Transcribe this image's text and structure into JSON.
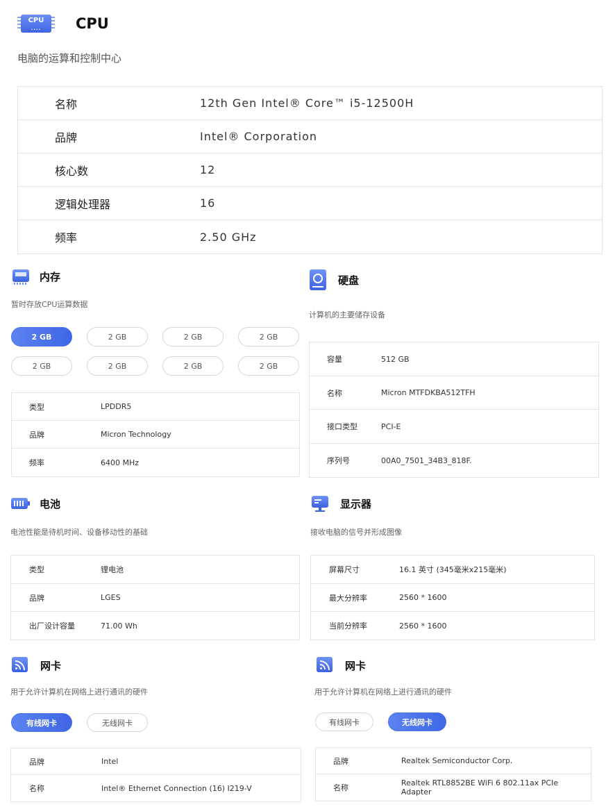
{
  "cpu": {
    "chip_label": "CPU",
    "title": "CPU",
    "description": "电脑的运算和控制中心",
    "rows": [
      {
        "label": "名称",
        "value": "12th Gen Intel® Core™ i5-12500H"
      },
      {
        "label": "品牌",
        "value": "Intel® Corporation"
      },
      {
        "label": "核心数",
        "value": "12"
      },
      {
        "label": "逻辑处理器",
        "value": "16"
      },
      {
        "label": "频率",
        "value": "2.50 GHz"
      }
    ]
  },
  "memory": {
    "title": "内存",
    "description": "暂时存放CPU运算数据",
    "modules": [
      "2 GB",
      "2 GB",
      "2 GB",
      "2 GB",
      "2 GB",
      "2 GB",
      "2 GB",
      "2 GB"
    ],
    "selected_index": 0,
    "rows": [
      {
        "label": "类型",
        "value": "LPDDR5"
      },
      {
        "label": "品牌",
        "value": "Micron Technology"
      },
      {
        "label": "频率",
        "value": "6400 MHz"
      }
    ]
  },
  "disk": {
    "title": "硬盘",
    "description": "计算机的主要储存设备",
    "rows": [
      {
        "label": "容量",
        "value": "512 GB"
      },
      {
        "label": "名称",
        "value": "Micron MTFDKBA512TFH"
      },
      {
        "label": "接口类型",
        "value": "PCI-E"
      },
      {
        "label": "序列号",
        "value": "00A0_7501_34B3_818F."
      }
    ]
  },
  "battery": {
    "title": "电池",
    "description": "电池性能是待机时间、设备移动性的基础",
    "rows": [
      {
        "label": "类型",
        "value": "锂电池"
      },
      {
        "label": "品牌",
        "value": "LGES"
      },
      {
        "label": "出厂设计容量",
        "value": "71.00 Wh"
      }
    ]
  },
  "display": {
    "title": "显示器",
    "description": "接收电脑的信号并形成图像",
    "rows": [
      {
        "label": "屏幕尺寸",
        "value": "16.1 英寸 (345毫米x215毫米)"
      },
      {
        "label": "最大分辨率",
        "value": "2560 * 1600"
      },
      {
        "label": "当前分辨率",
        "value": "2560 * 1600"
      }
    ]
  },
  "nic_wired": {
    "title": "网卡",
    "description": "用于允许计算机在网络上进行通讯的硬件",
    "tabs": [
      "有线网卡",
      "无线网卡"
    ],
    "active_tab": 0,
    "rows": [
      {
        "label": "品牌",
        "value": "Intel"
      },
      {
        "label": "名称",
        "value": "Intel® Ethernet Connection (16) I219-V"
      }
    ]
  },
  "nic_wireless": {
    "title": "网卡",
    "description": "用于允许计算机在网络上进行通讯的硬件",
    "tabs": [
      "有线网卡",
      "无线网卡"
    ],
    "active_tab": 1,
    "rows": [
      {
        "label": "品牌",
        "value": "Realtek Semiconductor Corp."
      },
      {
        "label": "名称",
        "value": "Realtek RTL8852BE WiFi 6 802.11ax PCIe Adapter"
      }
    ]
  },
  "colors": {
    "accent": "#4a6fea",
    "border": "#e3e3e3"
  }
}
